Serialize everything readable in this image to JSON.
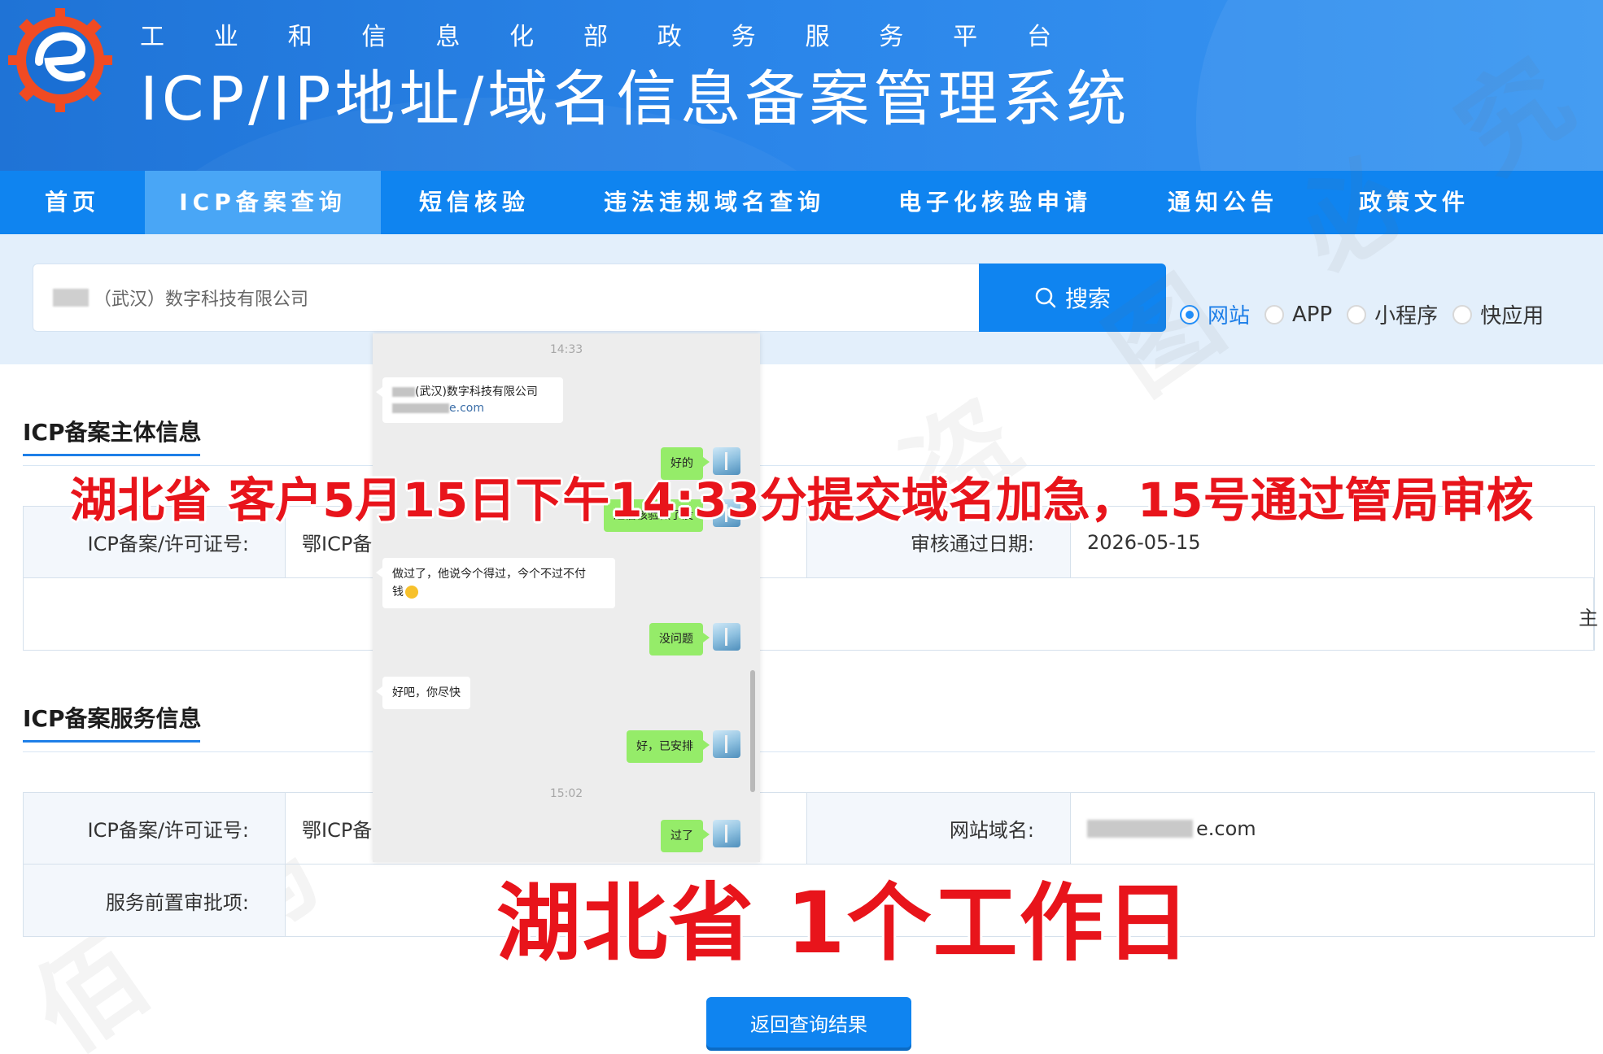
{
  "header": {
    "subtitle_chars": [
      "工",
      "业",
      "和",
      "信",
      "息",
      "化",
      "部",
      "政",
      "务",
      "服",
      "务",
      "平",
      "台"
    ],
    "title": "ICP/IP地址/域名信息备案管理系统"
  },
  "nav": {
    "items": [
      {
        "label": "首页"
      },
      {
        "label": "ICP备案查询"
      },
      {
        "label": "短信核验"
      },
      {
        "label": "违法违规域名查询"
      },
      {
        "label": "电子化核验申请"
      },
      {
        "label": "通知公告"
      },
      {
        "label": "政策文件"
      }
    ],
    "active": "ICP备案查询"
  },
  "search": {
    "value": "（武汉）数字科技有限公司",
    "button_label": "搜索",
    "radios": [
      {
        "label": "网站",
        "selected": true
      },
      {
        "label": "APP",
        "selected": false
      },
      {
        "label": "小程序",
        "selected": false
      },
      {
        "label": "快应用",
        "selected": false
      }
    ]
  },
  "subject_section": {
    "title": "ICP备案主体信息",
    "license_label": "ICP备案/许可证号:",
    "license_value": "鄂ICP备",
    "approval_date_label": "审核通过日期:",
    "approval_date_value": "2026-05-15",
    "side_glyph": "主"
  },
  "service_section": {
    "title": "ICP备案服务信息",
    "license_label": "ICP备案/许可证号:",
    "license_value": "鄂ICP备",
    "domain_label": "网站域名:",
    "domain_value": "e.com",
    "preapproval_label": "服务前置审批项:"
  },
  "chat": {
    "time_1": "14:33",
    "card_company": "(武汉)数字科技有限公司",
    "card_domain": "e.com",
    "msg_ok": "好的",
    "msg_sms_check": "短信核验做了没",
    "msg_done": "做过了，他说今个得过，今个不过不付",
    "msg_done_2": "钱",
    "msg_no_problem": "没问题",
    "msg_hurry": "好吧，你尽快",
    "msg_arranged": "好，已安排",
    "time_2": "15:02",
    "msg_passed": "过了"
  },
  "overlays": {
    "main": "湖北省 客户5月15日下午14:33分提交域名加急，15号通过管局审核",
    "bottom": "湖北省 1个工作日"
  },
  "watermark": {
    "chars": [
      "佰",
      "马",
      "企",
      "服",
      "盗",
      "图",
      "必",
      "究"
    ]
  },
  "back_button": {
    "label": "返回查询结果"
  },
  "colors": {
    "header_blue": "#2b86ea",
    "nav_blue": "#0f84f0",
    "nav_active": "#49a6f6",
    "overlay_red": "#e8141b",
    "chat_green": "#95ec69"
  }
}
